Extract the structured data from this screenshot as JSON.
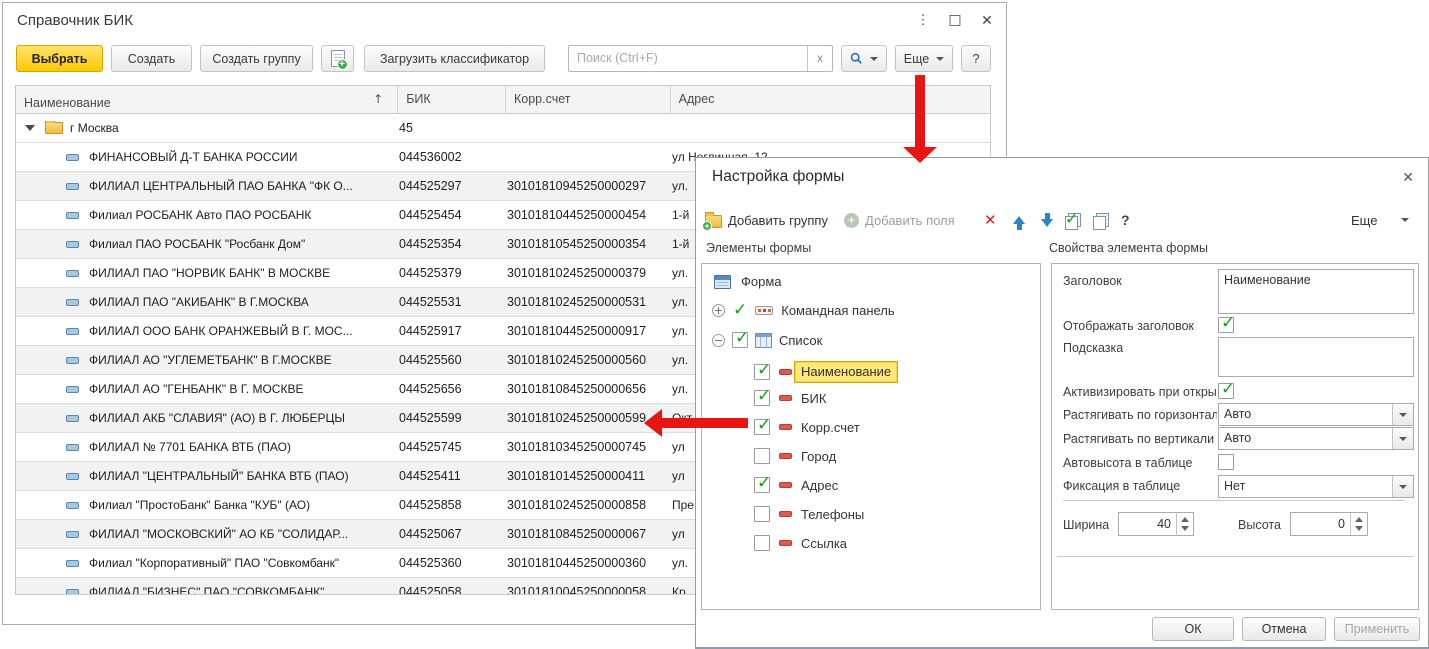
{
  "main_window": {
    "title": "Справочник БИК",
    "toolbar": {
      "select": "Выбрать",
      "create": "Создать",
      "create_group": "Создать группу",
      "load_classifier": "Загрузить классификатор",
      "search_placeholder": "Поиск (Ctrl+F)",
      "clear": "x",
      "more": "Еще",
      "help": "?"
    },
    "table": {
      "columns": [
        "Наименование",
        "БИК",
        "Корр.счет",
        "Адрес"
      ],
      "group_row": {
        "name": "г Москва",
        "bik": "45"
      },
      "rows": [
        {
          "name": "ФИНАНСОВЫЙ Д-Т БАНКА РОССИИ",
          "bik": "044536002",
          "corr": "",
          "addr": "ул Неглинная, 12"
        },
        {
          "name": "ФИЛИАЛ ЦЕНТРАЛЬНЫЙ ПАО БАНКА \"ФК О...",
          "bik": "044525297",
          "corr": "30101810945250000297",
          "addr": "ул."
        },
        {
          "name": "Филиал РОСБАНК Авто ПАО РОСБАНК",
          "bik": "044525454",
          "corr": "30101810445250000454",
          "addr": "1-й"
        },
        {
          "name": "Филиал ПАО РОСБАНК \"Росбанк Дом\"",
          "bik": "044525354",
          "corr": "30101810545250000354",
          "addr": "1-й"
        },
        {
          "name": "ФИЛИАЛ ПАО \"НОРВИК БАНК\" В МОСКВЕ",
          "bik": "044525379",
          "corr": "30101810245250000379",
          "addr": "ул."
        },
        {
          "name": "ФИЛИАЛ ПАО \"АКИБАНК\" В Г.МОСКВА",
          "bik": "044525531",
          "corr": "30101810245250000531",
          "addr": "ул."
        },
        {
          "name": "ФИЛИАЛ ООО БАНК ОРАНЖЕВЫЙ В Г. МОС...",
          "bik": "044525917",
          "corr": "30101810445250000917",
          "addr": "ул."
        },
        {
          "name": "ФИЛИАЛ АО \"УГЛЕМЕТБАНК\" В Г.МОСКВЕ",
          "bik": "044525560",
          "corr": "30101810245250000560",
          "addr": "ул."
        },
        {
          "name": "ФИЛИАЛ АО \"ГЕНБАНК\" В Г. МОСКВЕ",
          "bik": "044525656",
          "corr": "30101810845250000656",
          "addr": "ул."
        },
        {
          "name": "ФИЛИАЛ АКБ \"СЛАВИЯ\" (АО) В Г. ЛЮБЕРЦЫ",
          "bik": "044525599",
          "corr": "30101810245250000599",
          "addr": "Окт"
        },
        {
          "name": "ФИЛИАЛ № 7701 БАНКА ВТБ (ПАО)",
          "bik": "044525745",
          "corr": "30101810345250000745",
          "addr": "ул"
        },
        {
          "name": "ФИЛИАЛ \"ЦЕНТРАЛЬНЫЙ\" БАНКА ВТБ (ПАО)",
          "bik": "044525411",
          "corr": "30101810145250000411",
          "addr": "ул"
        },
        {
          "name": "Филиал \"ПростоБанк\" Банка \"КУБ\" (АО)",
          "bik": "044525858",
          "corr": "30101810245250000858",
          "addr": "Пре"
        },
        {
          "name": "ФИЛИАЛ \"МОСКОВСКИЙ\" АО КБ \"СОЛИДАР...",
          "bik": "044525067",
          "corr": "30101810845250000067",
          "addr": "ул"
        },
        {
          "name": "Филиал \"Корпоративный\" ПАО \"Совкомбанк\"",
          "bik": "044525360",
          "corr": "30101810445250000360",
          "addr": "ул."
        },
        {
          "name": "ФИЛИАЛ \"БИЗНЕС\" ПАО \"СОВКОМБАНК\"",
          "bik": "044525058",
          "corr": "30101810045250000058",
          "addr": "Кр"
        }
      ]
    }
  },
  "dialog": {
    "title": "Настройка формы",
    "close": "✕",
    "toolbar": {
      "add_group": "Добавить группу",
      "add_fields": "Добавить поля",
      "delete": "✕",
      "help": "?",
      "more": "Еще"
    },
    "left_panel_label": "Элементы формы",
    "right_panel_label": "Свойства элемента формы",
    "tree": {
      "root": "Форма",
      "command_panel": "Командная панель",
      "list": "Список",
      "fields": [
        {
          "label": "Наименование",
          "checked": true,
          "highlighted": true
        },
        {
          "label": "БИК",
          "checked": true,
          "highlighted": false
        },
        {
          "label": "Корр.счет",
          "checked": true,
          "highlighted": false
        },
        {
          "label": "Город",
          "checked": false,
          "highlighted": false
        },
        {
          "label": "Адрес",
          "checked": true,
          "highlighted": false
        },
        {
          "label": "Телефоны",
          "checked": false,
          "highlighted": false
        },
        {
          "label": "Ссылка",
          "checked": false,
          "highlighted": false
        }
      ]
    },
    "properties": {
      "title_label": "Заголовок",
      "title_value": "Наименование",
      "show_title_label": "Отображать заголовок",
      "show_title_checked": true,
      "hint_label": "Подсказка",
      "hint_value": "",
      "activate_label": "Активизировать при открытии",
      "activate_checked": true,
      "stretch_h_label": "Растягивать по горизонтали",
      "stretch_h_value": "Авто",
      "stretch_v_label": "Растягивать по вертикали",
      "stretch_v_value": "Авто",
      "autoheight_label": "Автовысота в таблице",
      "autoheight_checked": false,
      "fixation_label": "Фиксация в таблице",
      "fixation_value": "Нет",
      "width_label": "Ширина",
      "width_value": "40",
      "height_label": "Высота",
      "height_value": "0"
    },
    "buttons": {
      "ok": "ОК",
      "cancel": "Отмена",
      "apply": "Применить"
    }
  },
  "colors": {
    "accent_red": "#e81613",
    "select_yellow": "#fed001",
    "highlight_yellow": "#ffe878"
  }
}
